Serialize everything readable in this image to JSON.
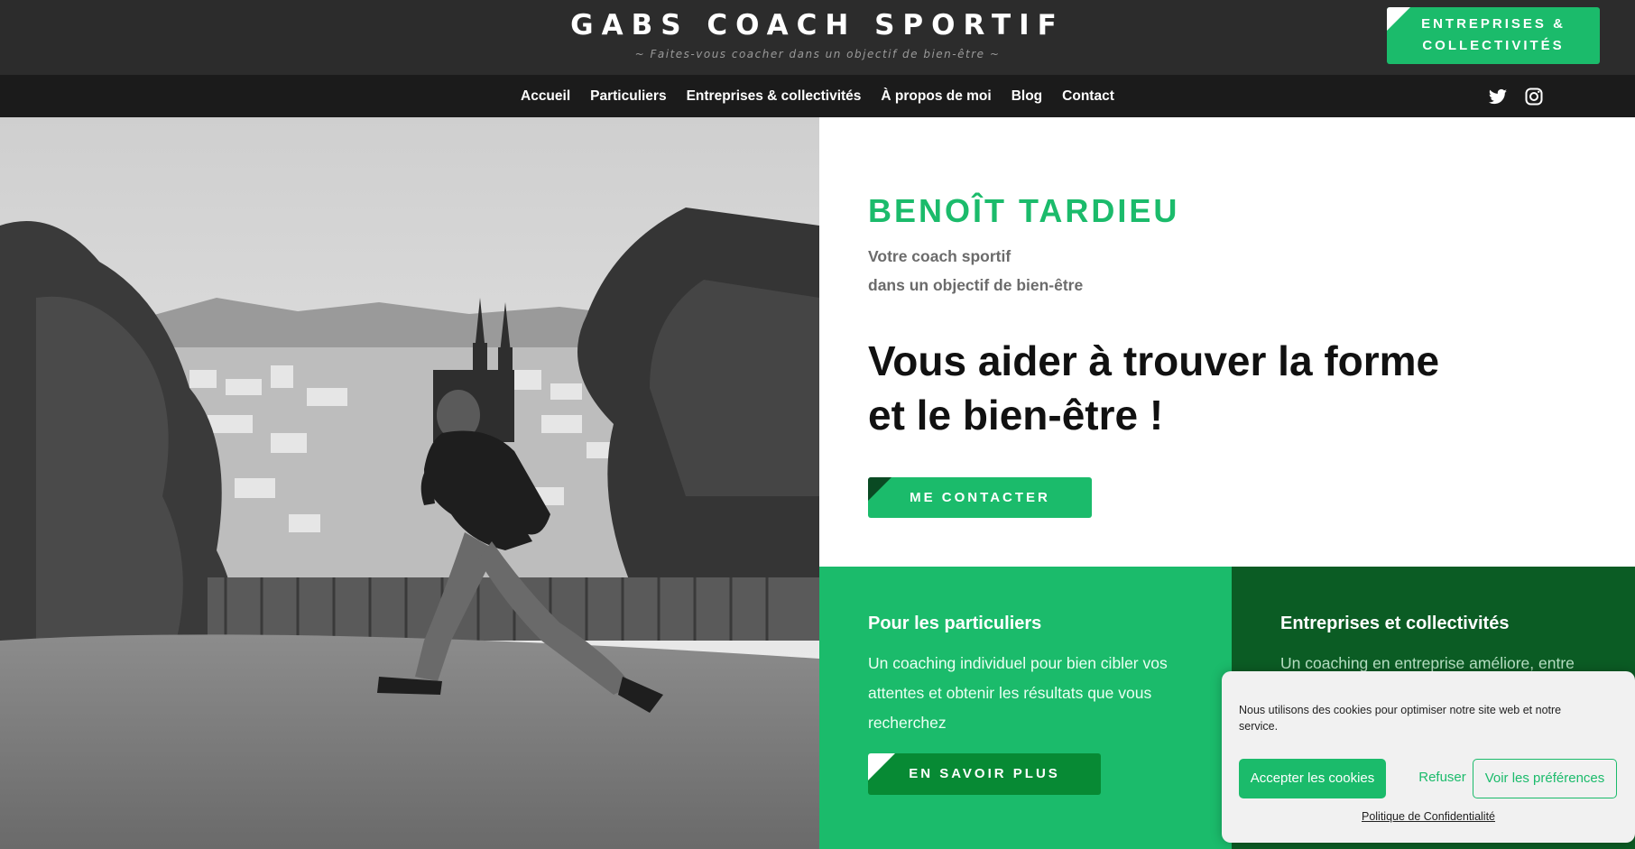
{
  "header": {
    "site_title": "GABS COACH SPORTIF",
    "tagline": "~ Faites-vous coacher dans un objectif de bien-être ~",
    "cta_line1": "ENTREPRISES &",
    "cta_line2": "COLLECTIVITÉS"
  },
  "nav": {
    "items": [
      {
        "label": "Accueil"
      },
      {
        "label": "Particuliers"
      },
      {
        "label": "Entreprises & collectivités"
      },
      {
        "label": "À propos de moi"
      },
      {
        "label": "Blog"
      },
      {
        "label": "Contact"
      }
    ],
    "social": [
      "twitter-icon",
      "instagram-icon"
    ]
  },
  "intro": {
    "name": "BENOÎT TARDIEU",
    "subtitle_line1": "Votre coach sportif",
    "subtitle_line2": "dans un objectif de bien-être",
    "headline_line1": "Vous aider à trouver la forme",
    "headline_line2": "et le bien-être !",
    "contact_button": "ME CONTACTER"
  },
  "cards": {
    "particuliers": {
      "title": "Pour les particuliers",
      "text": "Un coaching individuel pour bien cibler vos attentes et obtenir les résultats que vous recherchez",
      "button": "EN SAVOIR PLUS"
    },
    "entreprises": {
      "title": "Entreprises et collectivités",
      "text": "Un coaching en entreprise améliore, entre"
    }
  },
  "cookie": {
    "text": "Nous utilisons des cookies pour optimiser notre site web et notre service.",
    "accept": "Accepter les cookies",
    "refuse": "Refuser",
    "preferences": "Voir les préférences",
    "policy": "Politique de Confidentialité"
  },
  "colors": {
    "brand_green": "#1bbb6b",
    "dark_green": "#0b5c24",
    "header_bg": "#2c2c2c",
    "nav_bg": "#1b1b1b"
  }
}
